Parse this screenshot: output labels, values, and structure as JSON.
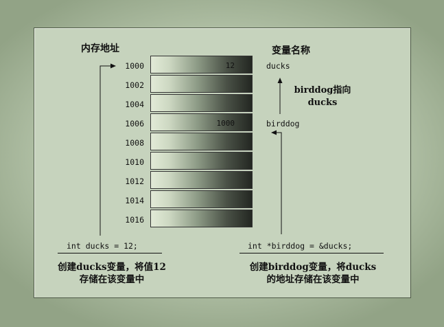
{
  "headings": {
    "address": "内存地址",
    "variable_name": "变量名称"
  },
  "memory": [
    {
      "address": "1000",
      "value": "12",
      "variable": "ducks"
    },
    {
      "address": "1002",
      "value": "",
      "variable": ""
    },
    {
      "address": "1004",
      "value": "",
      "variable": ""
    },
    {
      "address": "1006",
      "value": "1000",
      "variable": "birddog"
    },
    {
      "address": "1008",
      "value": "",
      "variable": ""
    },
    {
      "address": "1010",
      "value": "",
      "variable": ""
    },
    {
      "address": "1012",
      "value": "",
      "variable": ""
    },
    {
      "address": "1014",
      "value": "",
      "variable": ""
    },
    {
      "address": "1016",
      "value": "",
      "variable": ""
    }
  ],
  "pointer_note": {
    "line1": "birddog指向",
    "line2": "ducks"
  },
  "left_code": {
    "statement": "int ducks = 12;",
    "caption_line1": "创建ducks变量，将值12",
    "caption_line2": "存储在该变量中"
  },
  "right_code": {
    "statement": "int *birddog = &ducks;",
    "caption_line1": "创建birddog变量，将ducks",
    "caption_line2": "的地址存储在该变量中"
  }
}
